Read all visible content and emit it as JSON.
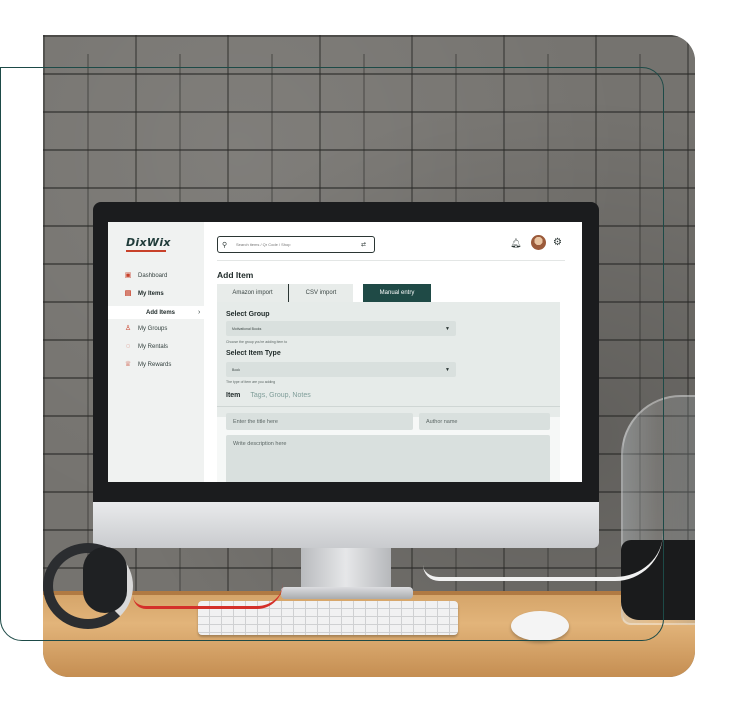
{
  "app": {
    "logo": "DixWix",
    "brand_accent": "#c8412a",
    "primary": "#1f4a46"
  },
  "sidebar": {
    "items": [
      {
        "label": "Dashboard",
        "icon": "dashboard-icon"
      },
      {
        "label": "My Items",
        "icon": "items-icon",
        "active": true
      },
      {
        "label": "Add Items",
        "icon": "chevron-right-icon",
        "sub": true
      },
      {
        "label": "My Groups",
        "icon": "groups-icon"
      },
      {
        "label": "My Rentals",
        "icon": "rentals-icon"
      },
      {
        "label": "My Rewards",
        "icon": "rewards-icon"
      }
    ]
  },
  "topbar": {
    "search_placeholder": "Search items / Qr Code / Shop"
  },
  "page": {
    "title": "Add Item",
    "tabs": [
      {
        "label": "Amazon import"
      },
      {
        "label": "CSV import"
      },
      {
        "label": "Manual entry",
        "active": true
      }
    ]
  },
  "form": {
    "group": {
      "title": "Select Group",
      "value": "Motivational Books",
      "hint": "Choose the group you're adding item to"
    },
    "item_type": {
      "title": "Select Item Type",
      "value": "Book",
      "hint": "The type of item are you adding"
    },
    "subtabs": [
      "Item",
      "Tags, Group, Notes"
    ],
    "title_placeholder": "Enter the title here",
    "author_placeholder": "Author name",
    "description_placeholder": "Write description here"
  }
}
